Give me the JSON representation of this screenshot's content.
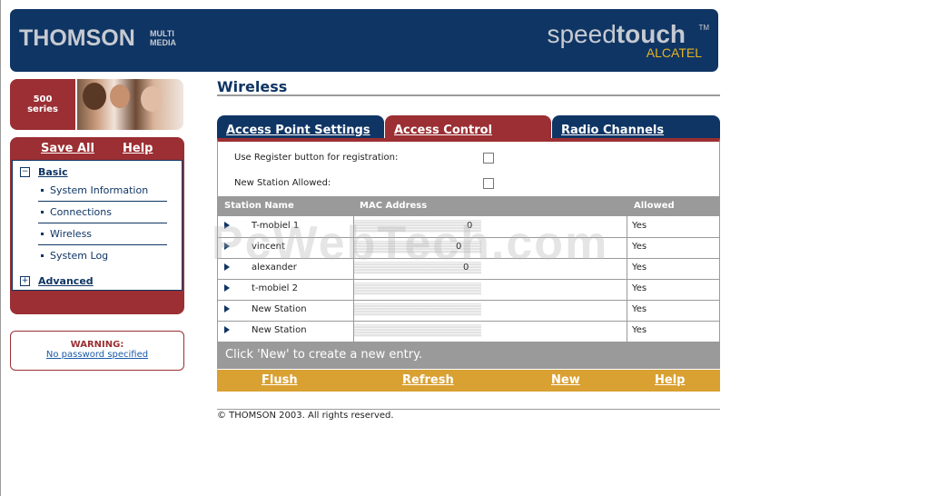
{
  "header": {
    "thomson_logo": "THOMSON",
    "multimedia_logo": "MULTI MEDIA",
    "speedtouch_light": "speed",
    "speedtouch_bold": "touch",
    "tm": "TM",
    "alcatel": "ALCATEL"
  },
  "series_badge": {
    "number": "500",
    "label": "series"
  },
  "nav": {
    "save_all": "Save All",
    "help": "Help",
    "basic": {
      "label": "Basic",
      "toggle": "−"
    },
    "items": [
      {
        "label": "System Information"
      },
      {
        "label": "Connections"
      },
      {
        "label": "Wireless"
      },
      {
        "label": "System Log"
      }
    ],
    "advanced": {
      "label": "Advanced",
      "toggle": "+"
    }
  },
  "warning": {
    "title": "WARNING:",
    "link": "No password specified"
  },
  "page": {
    "title": "Wireless"
  },
  "tabs": [
    {
      "label": "Access Point Settings"
    },
    {
      "label": "Access Control"
    },
    {
      "label": "Radio Channels"
    }
  ],
  "options": [
    {
      "label": "Use Register button for registration:",
      "checked": false
    },
    {
      "label": "New Station Allowed:",
      "checked": false
    }
  ],
  "table": {
    "columns": [
      "Station Name",
      "MAC Address",
      "Allowed"
    ],
    "rows": [
      {
        "name": "T-mobiel 1",
        "mac": "0",
        "allowed": "Yes"
      },
      {
        "name": "vincent",
        "mac": "0",
        "allowed": "Yes"
      },
      {
        "name": "alexander",
        "mac": "0",
        "allowed": "Yes"
      },
      {
        "name": "t-mobiel 2",
        "mac": "",
        "allowed": "Yes"
      },
      {
        "name": "New Station",
        "mac": "",
        "allowed": "Yes"
      },
      {
        "name": "New Station",
        "mac": "",
        "allowed": "Yes"
      }
    ]
  },
  "hint": "Click 'New' to create a new entry.",
  "actions": {
    "flush": "Flush",
    "refresh": "Refresh",
    "new": "New",
    "help": "Help"
  },
  "footer": {
    "copyright": "© THOMSON 2003. All rights reserved."
  },
  "watermark": "PcWebTech.com"
}
